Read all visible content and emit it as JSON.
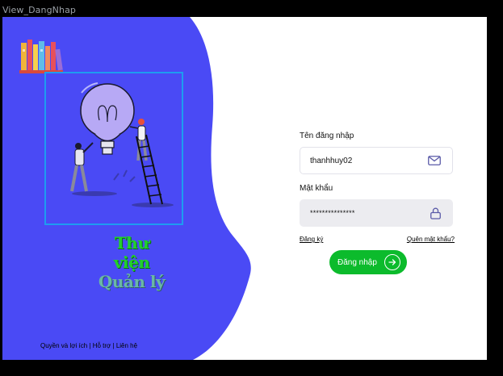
{
  "window": {
    "title": "View_DangNhap"
  },
  "brand": {
    "line1": "Thư viện",
    "line2": "Quản lý"
  },
  "footer": {
    "rights": "Quyền và lợi ích",
    "support": "Hỗ trợ",
    "contact": "Liên hệ",
    "separator": " | "
  },
  "login": {
    "username_label": "Tên đăng nhập",
    "username_value": "thanhhuy02",
    "password_label": "Mật khẩu",
    "password_value": "***************",
    "register_link": "Đăng ký",
    "forgot_link": "Quên mật khẩu?",
    "submit_label": "Đăng nhập"
  },
  "colors": {
    "panel": "#4a4af5",
    "accent_green": "#0cbb2c",
    "frame_border": "#1e9cf0"
  },
  "icons": {
    "username": "mail-icon",
    "password": "lock-icon",
    "submit": "arrow-right-icon",
    "logo": "books-icon"
  }
}
